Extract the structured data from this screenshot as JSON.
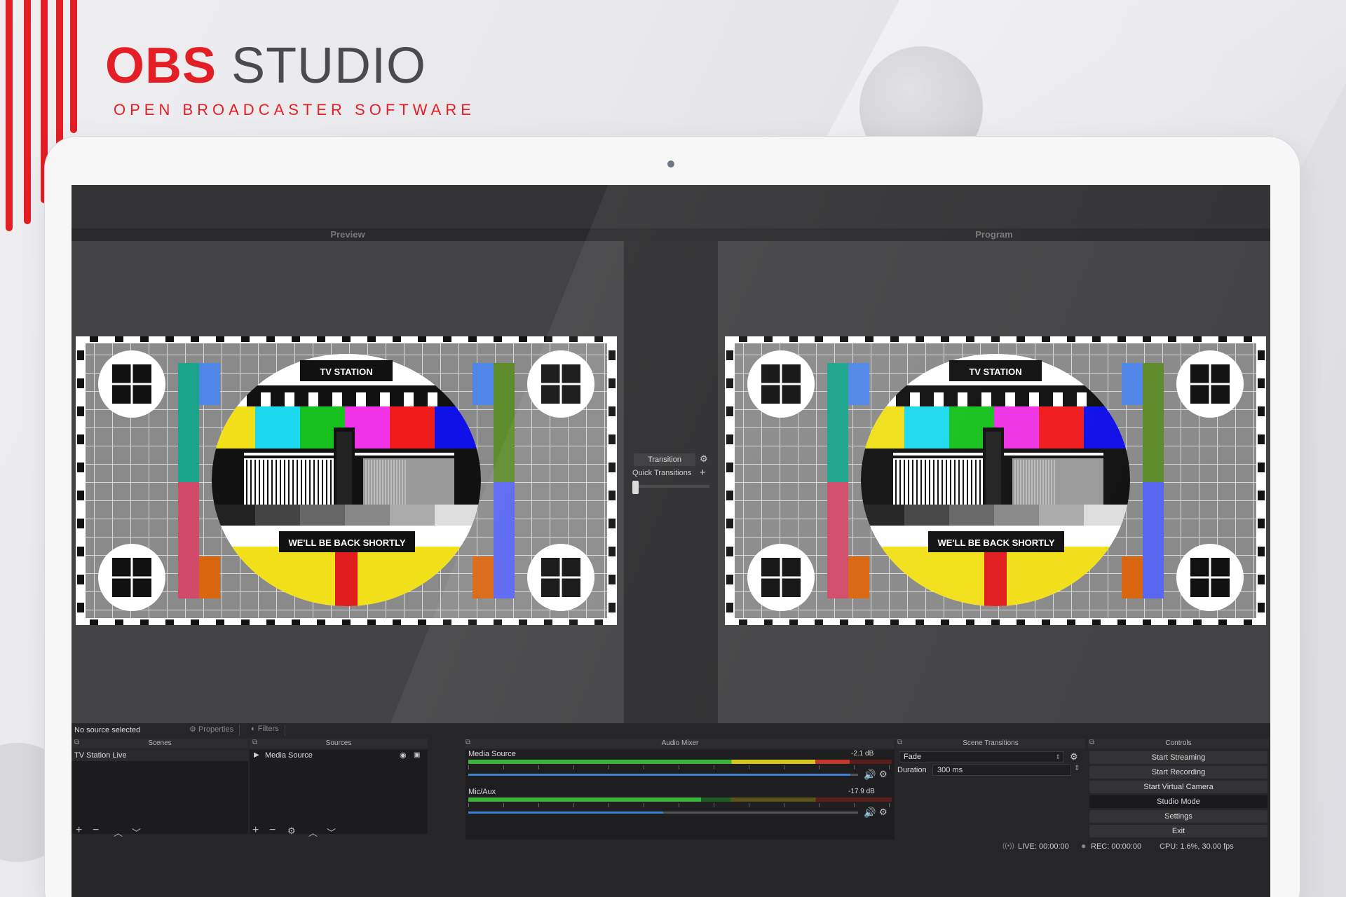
{
  "branding": {
    "title_part1": "OBS",
    "title_part2": "STUDIO",
    "tagline": "OPEN BROADCASTER SOFTWARE"
  },
  "colors": {
    "brand_red": "#e31e24",
    "panel_bg": "#1c1c1e",
    "meter_green": "#3cb43c",
    "meter_yellow": "#d6c622",
    "meter_red": "#c0392b",
    "volume_blue": "#3b82d6"
  },
  "app": {
    "preview_label": "Preview",
    "program_label": "Program",
    "transition": {
      "button_label": "Transition",
      "gear_icon": "gear-icon",
      "quick_transitions_label": "Quick Transitions",
      "plus_icon": "plus-icon"
    },
    "test_card": {
      "top_label": "TV STATION",
      "bottom_label": "WE'LL BE BACK SHORTLY"
    },
    "source_status": "No source selected",
    "properties_label": "Properties",
    "filters_label": "Filters",
    "scenes": {
      "title": "Scenes",
      "items": [
        "TV Station Live"
      ]
    },
    "sources": {
      "title": "Sources",
      "items": [
        {
          "label": "Media Source",
          "visible_icon": "eye-icon",
          "lock_icon": "lock-icon"
        }
      ]
    },
    "audio_mixer": {
      "title": "Audio Mixer",
      "channels": [
        {
          "name": "Media Source",
          "db": "-2.1 dB",
          "level": 0.9,
          "volume": 0.98
        },
        {
          "name": "Mic/Aux",
          "db": "-17.9 dB",
          "level": 0.55,
          "volume": 0.5
        }
      ]
    },
    "scene_transitions": {
      "title": "Scene Transitions",
      "selected": "Fade",
      "duration_label": "Duration",
      "duration_value": "300 ms"
    },
    "controls": {
      "title": "Controls",
      "buttons": [
        "Start Streaming",
        "Start Recording",
        "Start Virtual Camera",
        "Studio Mode",
        "Settings",
        "Exit"
      ]
    },
    "status": {
      "live": "LIVE: 00:00:00",
      "rec": "REC: 00:00:00",
      "cpu": "CPU: 1.6%, 30.00 fps"
    }
  }
}
